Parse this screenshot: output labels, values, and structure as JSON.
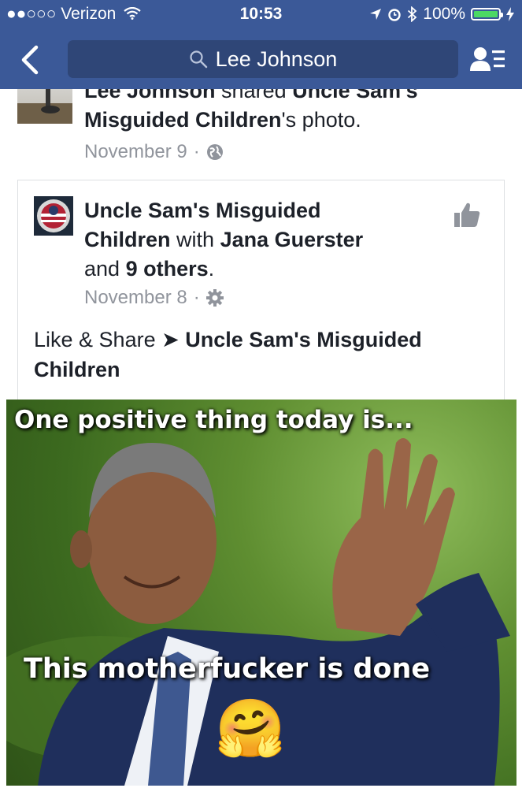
{
  "status_bar": {
    "signal": "●●○○○",
    "carrier": "Verizon",
    "time": "10:53",
    "battery": "100%",
    "battery_level": 1.0
  },
  "nav": {
    "search_text": "Lee Johnson"
  },
  "previous_story": {
    "actor": "Lee Johnson",
    "verb": "shared",
    "page": "Uncle Sam's",
    "page_cont": "Misguided Children",
    "object": "'s photo.",
    "date": "November 9",
    "separator": "·"
  },
  "post": {
    "page_line1": "Uncle Sam's Misguided",
    "page_line2": "Children",
    "with": "with",
    "tagged": "Jana Guerster",
    "and": "and",
    "others": "9 others",
    "period": ".",
    "date": "November 8",
    "separator": "·",
    "text_prefix": "Like & Share",
    "text_arrow": "➤",
    "text_page": "Uncle Sam's Misguided Children"
  },
  "meme": {
    "top_text": "One positive thing today is...",
    "bottom_text": "This motherfucker is done",
    "emoji": "🤗"
  },
  "colors": {
    "header": "#3b5998",
    "search_bg": "#2f4677",
    "text": "#1d2129",
    "meta": "#90949c",
    "card_border": "#dddfe2"
  }
}
